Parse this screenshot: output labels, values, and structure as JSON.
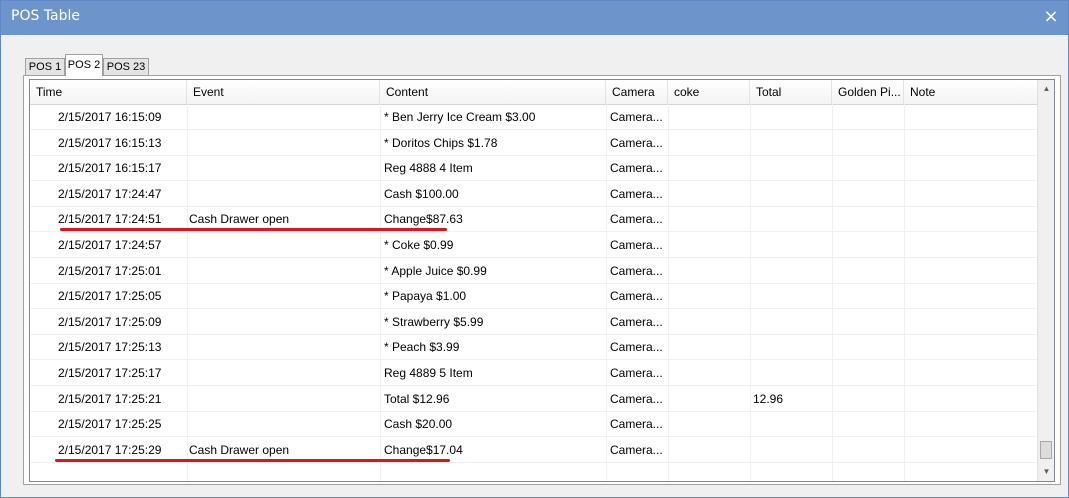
{
  "window": {
    "title": "POS Table",
    "close_icon": "×"
  },
  "tabs": [
    {
      "label": "POS 1",
      "active": false
    },
    {
      "label": "POS 2",
      "active": true
    },
    {
      "label": "POS 23",
      "active": false
    }
  ],
  "table": {
    "columns": [
      "Time",
      "Event",
      "Content",
      "Camera",
      "coke",
      "Total",
      "Golden Pi...",
      "Note"
    ],
    "rows": [
      {
        "time": "2/15/2017 16:15:09",
        "event": "",
        "content": "* Ben Jerry Ice Cream $3.00",
        "camera": "Camera...",
        "coke": "",
        "total": "",
        "golden": "",
        "note": ""
      },
      {
        "time": "2/15/2017 16:15:13",
        "event": "",
        "content": "* Doritos Chips $1.78",
        "camera": "Camera...",
        "coke": "",
        "total": "",
        "golden": "",
        "note": ""
      },
      {
        "time": "2/15/2017 16:15:17",
        "event": "",
        "content": "Reg 4888 4 Item",
        "camera": "Camera...",
        "coke": "",
        "total": "",
        "golden": "",
        "note": ""
      },
      {
        "time": "2/15/2017 17:24:47",
        "event": "",
        "content": "Cash $100.00",
        "camera": "Camera...",
        "coke": "",
        "total": "",
        "golden": "",
        "note": ""
      },
      {
        "time": "2/15/2017 17:24:51",
        "event": "Cash Drawer open",
        "content": "Change$87.63",
        "camera": "Camera...",
        "coke": "",
        "total": "",
        "golden": "",
        "note": ""
      },
      {
        "time": "2/15/2017 17:24:57",
        "event": "",
        "content": "* Coke $0.99",
        "camera": "Camera...",
        "coke": "",
        "total": "",
        "golden": "",
        "note": ""
      },
      {
        "time": "2/15/2017 17:25:01",
        "event": "",
        "content": "* Apple Juice $0.99",
        "camera": "Camera...",
        "coke": "",
        "total": "",
        "golden": "",
        "note": ""
      },
      {
        "time": "2/15/2017 17:25:05",
        "event": "",
        "content": "* Papaya $1.00",
        "camera": "Camera...",
        "coke": "",
        "total": "",
        "golden": "",
        "note": ""
      },
      {
        "time": "2/15/2017 17:25:09",
        "event": "",
        "content": "* Strawberry $5.99",
        "camera": "Camera...",
        "coke": "",
        "total": "",
        "golden": "",
        "note": ""
      },
      {
        "time": "2/15/2017 17:25:13",
        "event": "",
        "content": "* Peach $3.99",
        "camera": "Camera...",
        "coke": "",
        "total": "",
        "golden": "",
        "note": ""
      },
      {
        "time": "2/15/2017 17:25:17",
        "event": "",
        "content": "Reg 4889 5 Item",
        "camera": "Camera...",
        "coke": "",
        "total": "",
        "golden": "",
        "note": ""
      },
      {
        "time": "2/15/2017 17:25:21",
        "event": "",
        "content": "Total $12.96",
        "camera": "Camera...",
        "coke": "",
        "total": "12.96",
        "golden": "",
        "note": ""
      },
      {
        "time": "2/15/2017 17:25:25",
        "event": "",
        "content": "Cash $20.00",
        "camera": "Camera...",
        "coke": "",
        "total": "",
        "golden": "",
        "note": ""
      },
      {
        "time": "2/15/2017 17:25:29",
        "event": "Cash Drawer open",
        "content": "Change$17.04",
        "camera": "Camera...",
        "coke": "",
        "total": "",
        "golden": "",
        "note": ""
      }
    ]
  },
  "annotations": {
    "highlight_color": "#e0141e",
    "highlighted_rows": [
      4,
      13
    ]
  },
  "scrollbar": {
    "up_icon": "▲",
    "down_icon": "▼"
  }
}
